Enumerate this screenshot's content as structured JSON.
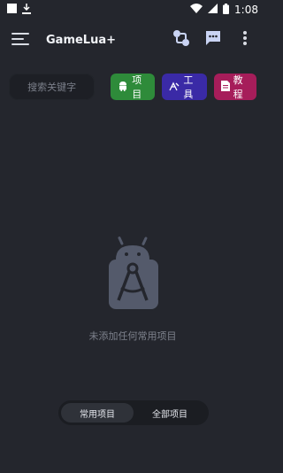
{
  "statusbar": {
    "time": "1:08"
  },
  "appbar": {
    "title": "GameLua+"
  },
  "search": {
    "placeholder": "搜索关键字"
  },
  "chips": {
    "project": "项目",
    "tools": "工具",
    "tutorial": "教程"
  },
  "empty_state": {
    "text": "未添加任何常用项目"
  },
  "tabs": {
    "common": "常用项目",
    "all": "全部项目"
  },
  "colors": {
    "background": "#24262d",
    "project": "#2e8b3a",
    "tools": "#3a2aa6",
    "tutorial": "#a61d5a"
  }
}
